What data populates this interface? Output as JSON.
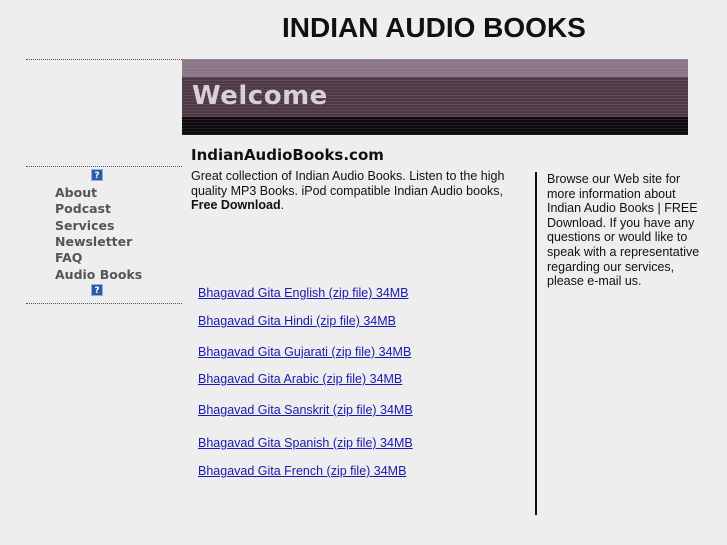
{
  "header": {
    "title": "INDIAN AUDIO BOOKS"
  },
  "banner": {
    "text": "Welcome"
  },
  "nav": {
    "items": [
      {
        "label": "About"
      },
      {
        "label": "Podcast"
      },
      {
        "label": "Services"
      },
      {
        "label": "Newsletter"
      },
      {
        "label": "FAQ"
      },
      {
        "label": "Audio Books"
      }
    ],
    "icon_glyph": "?"
  },
  "main": {
    "heading": "IndianAudioBooks.com",
    "intro_text": "Great collection of Indian Audio Books. Listen to the high quality MP3 Books. iPod compatible Indian Audio books, ",
    "intro_bold": "Free Download",
    "intro_end": ".",
    "downloads": [
      {
        "label": "Bhagavad Gita English (zip file) 34MB"
      },
      {
        "label": "Bhagavad Gita Hindi (zip file) 34MB"
      },
      {
        "label": "Bhagavad Gita Gujarati (zip file) 34MB"
      },
      {
        "label": "Bhagavad Gita Arabic (zip file) 34MB"
      },
      {
        "label": "Bhagavad Gita Sanskrit (zip file) 34MB"
      },
      {
        "label": "Bhagavad Gita Spanish (zip file) 34MB"
      },
      {
        "label": "Bhagavad Gita French (zip file) 34MB"
      }
    ]
  },
  "aside": {
    "text": "Browse our Web site for more information about Indian Audio Books | FREE Download. If you have any questions or would like to speak with a representative regarding our services, please e-mail us."
  },
  "colors": {
    "background": "#eeeeee",
    "link": "#1a1ab0",
    "nav_text": "#555555",
    "banner_band": "#4e3845"
  }
}
